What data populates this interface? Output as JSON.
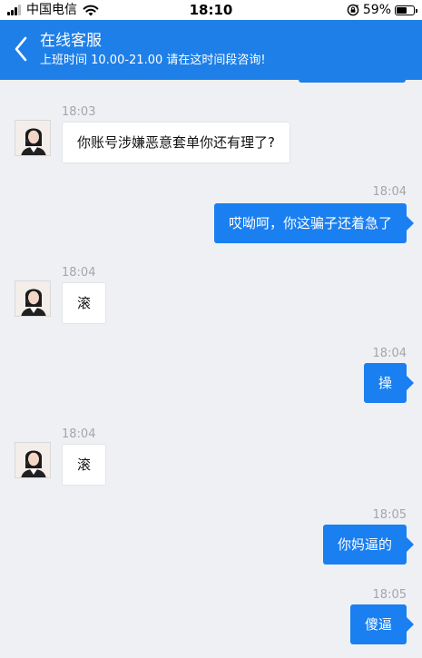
{
  "status_bar": {
    "carrier": "中国电信",
    "time": "18:10",
    "battery_percent": "59%",
    "battery_level": 0.59,
    "signal_icon": "signal-bars-icon",
    "wifi_icon": "wifi-icon",
    "rotation_lock_icon": "rotation-lock-icon"
  },
  "header": {
    "back_icon": "chevron-left-icon",
    "title": "在线客服",
    "subtitle": "上班时间 10.00-21.00 请在这时间段咨询!",
    "background_color": "#1e7fe8"
  },
  "messages": [
    {
      "side": "in",
      "time": "18:03",
      "text": "你账号涉嫌恶意套单你还有理了?"
    },
    {
      "side": "out",
      "time": "18:04",
      "text": "哎呦呵，你这骗子还着急了"
    },
    {
      "side": "in",
      "time": "18:04",
      "text": "滚"
    },
    {
      "side": "out",
      "time": "18:04",
      "text": "操"
    },
    {
      "side": "in",
      "time": "18:04",
      "text": "滚"
    },
    {
      "side": "out",
      "time": "18:05",
      "text": "你妈逼的"
    },
    {
      "side": "out",
      "time": "18:05",
      "text": "傻逼"
    }
  ],
  "colors": {
    "outgoing_bubble": "#1a7ff0",
    "incoming_bubble": "#ffffff",
    "chat_background": "#eef0f4",
    "timestamp": "#a3a6ab"
  }
}
